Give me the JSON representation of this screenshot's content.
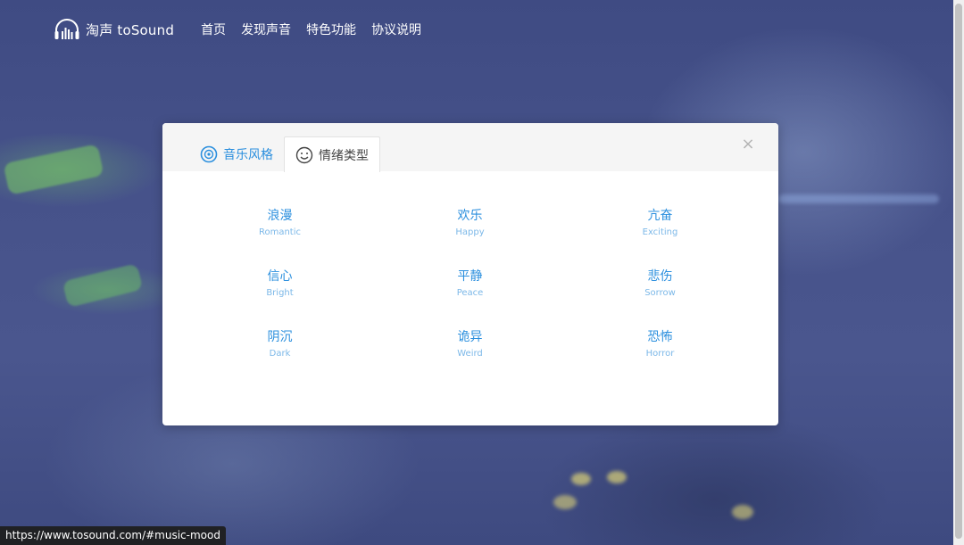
{
  "nav": {
    "brand": "淘声 toSound",
    "items": [
      "首页",
      "发现声音",
      "特色功能",
      "协议说明"
    ]
  },
  "modal": {
    "tabs": [
      {
        "label": "音乐风格",
        "icon": "disc-icon",
        "active": false
      },
      {
        "label": "情绪类型",
        "icon": "smiley-icon",
        "active": true
      }
    ],
    "close_label": "×",
    "moods": [
      {
        "cn": "浪漫",
        "en": "Romantic"
      },
      {
        "cn": "欢乐",
        "en": "Happy"
      },
      {
        "cn": "亢奋",
        "en": "Exciting"
      },
      {
        "cn": "信心",
        "en": "Bright"
      },
      {
        "cn": "平静",
        "en": "Peace"
      },
      {
        "cn": "悲伤",
        "en": "Sorrow"
      },
      {
        "cn": "阴沉",
        "en": "Dark"
      },
      {
        "cn": "诡异",
        "en": "Weird"
      },
      {
        "cn": "恐怖",
        "en": "Horror"
      }
    ]
  },
  "status_url": "https://www.tosound.com/#music-mood",
  "colors": {
    "accent": "#2b8fde",
    "accent_light": "#7cb8e8",
    "background": "#46528a"
  }
}
